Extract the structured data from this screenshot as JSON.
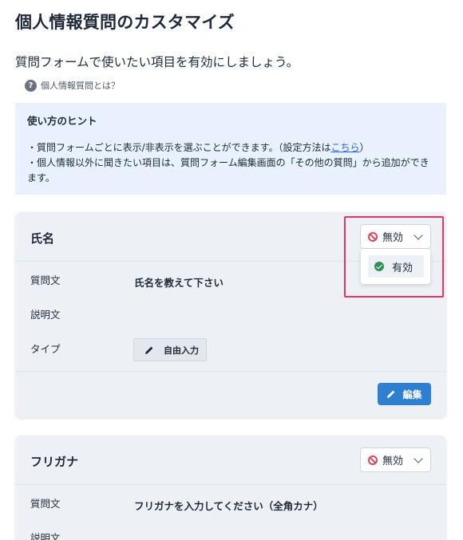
{
  "page": {
    "title": "個人情報質問のカスタマイズ",
    "description": "質問フォームで使いたい項目を有効にしましょう。",
    "help_link": "個人情報質問とは？",
    "help_icon": "question-circle-icon"
  },
  "hint": {
    "title": "使い方のヒント",
    "line1_prefix": "・質問フォームごとに表示/非表示を選ぶことができます。（設定方法は",
    "line1_link": "こちら",
    "line1_suffix": "）",
    "line2": "・個人情報以外に聞きたい項目は、質問フォーム編集画面の「その他の質問」から追加ができます。"
  },
  "cards": [
    {
      "title": "氏名",
      "status": "無効",
      "status_icon": "ban-icon",
      "dropdown_open": true,
      "dropdown_options": [
        {
          "label": "有効",
          "icon": "check-circle-icon"
        }
      ],
      "rows": [
        {
          "label": "質問文",
          "value": "氏名を教えて下さい"
        },
        {
          "label": "説明文",
          "value": ""
        },
        {
          "label": "タイプ",
          "value": "自由入力"
        }
      ],
      "edit_label": "編集"
    },
    {
      "title": "フリガナ",
      "status": "無効",
      "status_icon": "ban-icon",
      "rows": [
        {
          "label": "質問文",
          "value": "フリガナを入力してください（全角カナ）"
        },
        {
          "label": "説明文",
          "value": ""
        }
      ]
    }
  ],
  "colors": {
    "accent": "#2f7fd0",
    "highlight": "#e8336a",
    "hint_bg": "#e8f1fd",
    "card_bg": "#edf1f5",
    "disabled_red": "#e0455c",
    "enabled_green": "#2f8f5b"
  }
}
